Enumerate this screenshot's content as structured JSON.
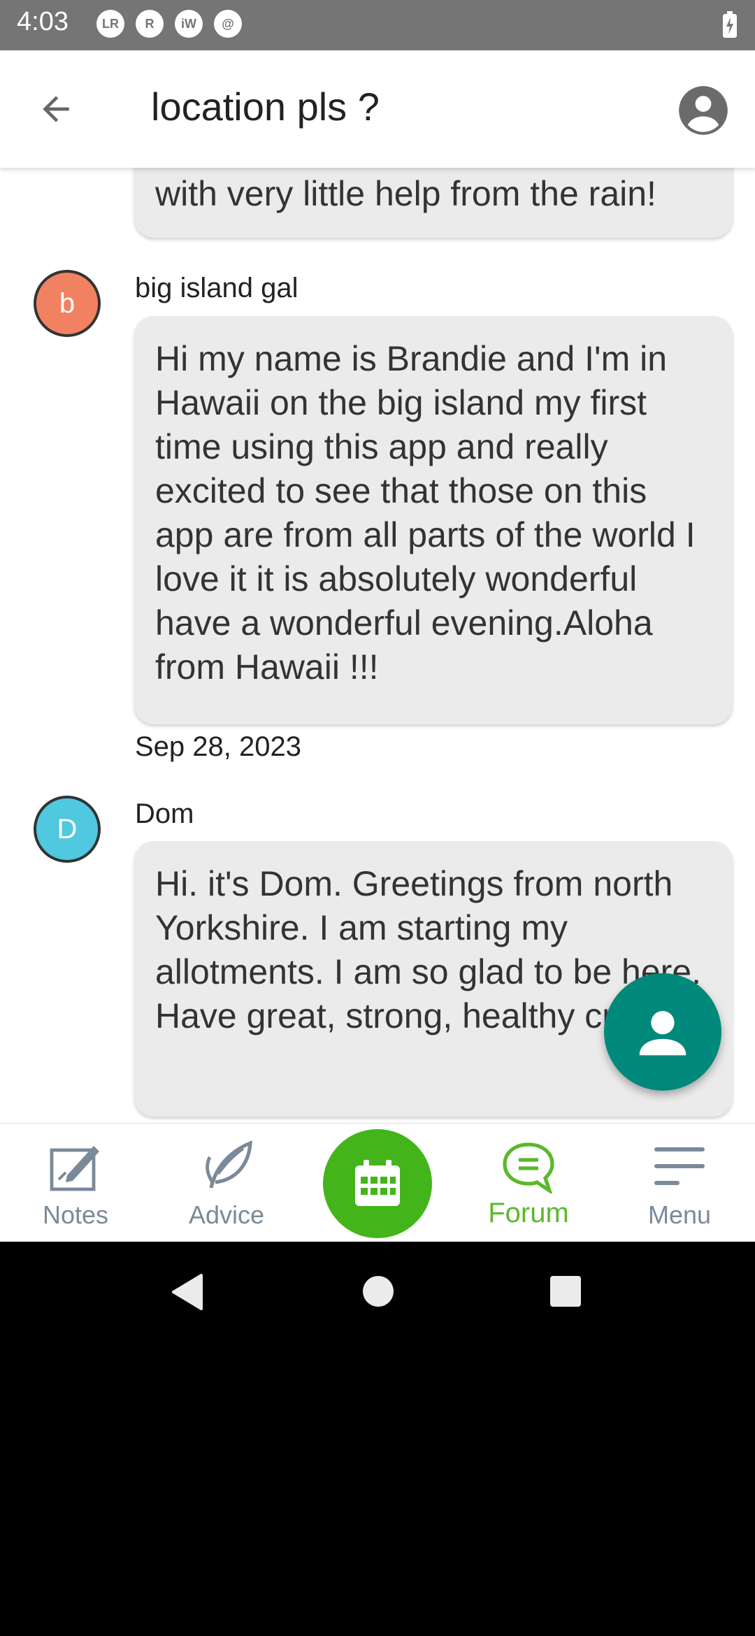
{
  "status_bar": {
    "time": "4:03",
    "icons": [
      "LR",
      "R",
      "iW",
      "@"
    ]
  },
  "header": {
    "title": "location pls ?"
  },
  "posts": [
    {
      "text": "with very little help from the rain!"
    },
    {
      "author": "big island gal",
      "avatar_letter": "b",
      "avatar_color": "#f08262",
      "text": "Hi my name is Brandie and I'm in Hawaii on the big island my first time using this app and really excited to see that those on this app are from all parts of the world I love it it is absolutely wonderful  have a wonderful evening.Aloha from Hawaii !!!",
      "date": "Sep 28, 2023"
    },
    {
      "author": "Dom",
      "avatar_letter": "D",
      "avatar_color": "#4fc8e0",
      "text": "Hi. it's Dom. Greetings from north Yorkshire. I am starting my allotments. I am so glad to be here. Have great, strong, healthy crops."
    }
  ],
  "bottom_nav": {
    "notes_label": "Notes",
    "advice_label": "Advice",
    "forum_label": "Forum",
    "menu_label": "Menu",
    "active_color": "#5cb82b",
    "inactive_color": "#7b8a99"
  },
  "icons": {
    "back": "arrow-left-icon",
    "profile": "account-circle-icon",
    "fab": "person-icon",
    "calendar": "calendar-icon"
  }
}
